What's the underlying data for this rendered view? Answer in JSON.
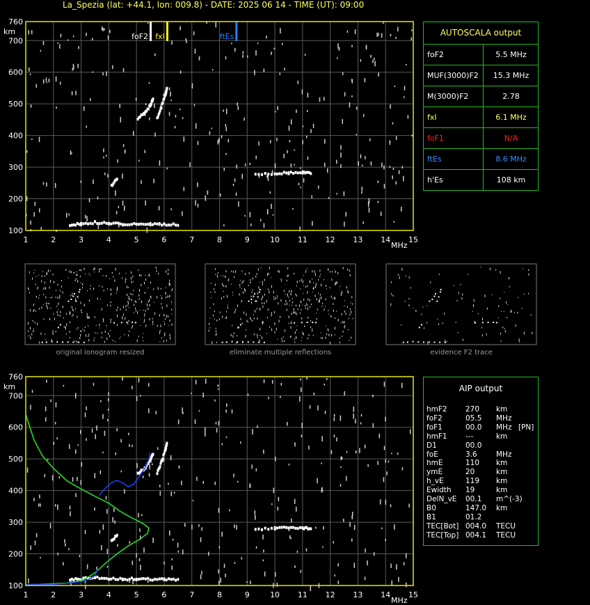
{
  "header": {
    "title": "La_Spezia (lat: +44.1, lon: 009.8) - DATE: 2025 06 14 - TIME (UT): 09:00"
  },
  "chart_data": [
    {
      "type": "scatter",
      "title": "",
      "ylabel": "km",
      "xlabel": "MHz",
      "xlim": [
        1,
        15
      ],
      "ylim": [
        100,
        760
      ],
      "x_ticks": [
        1,
        2,
        3,
        4,
        5,
        6,
        7,
        8,
        9,
        10,
        11,
        12,
        13,
        14,
        15
      ],
      "y_ticks": [
        100,
        200,
        300,
        400,
        500,
        600,
        700,
        760
      ],
      "grid": true,
      "markers": [
        {
          "label": "foF2",
          "x": 5.5,
          "color": "#ffffff"
        },
        {
          "label": "fxI",
          "x": 6.1,
          "color": "#ffff00"
        },
        {
          "label": "ftEs",
          "x": 8.6,
          "color": "#2a7fff"
        }
      ],
      "traces": [
        {
          "name": "",
          "points": [
            [
              2.6,
              118
            ],
            [
              3.0,
              120
            ],
            [
              3.5,
              125
            ],
            [
              4.0,
              122
            ],
            [
              4.5,
              120
            ],
            [
              5.0,
              121
            ],
            [
              5.5,
              120
            ],
            [
              6.0,
              119
            ],
            [
              6.5,
              118
            ]
          ]
        },
        {
          "name": "",
          "points": [
            [
              4.1,
              240
            ],
            [
              4.3,
              262
            ]
          ]
        },
        {
          "name": "",
          "points": [
            [
              5.05,
              455
            ],
            [
              5.3,
              470
            ],
            [
              5.5,
              495
            ],
            [
              5.6,
              515
            ]
          ]
        },
        {
          "name": "",
          "points": [
            [
              5.75,
              455
            ],
            [
              5.9,
              490
            ],
            [
              6.05,
              530
            ],
            [
              6.1,
              550
            ]
          ]
        },
        {
          "name": "",
          "points": [
            [
              9.3,
              278
            ],
            [
              10.0,
              280
            ],
            [
              10.5,
              282
            ],
            [
              11.0,
              282
            ],
            [
              11.3,
              280
            ]
          ]
        }
      ]
    },
    {
      "type": "scatter",
      "title": "",
      "ylabel": "km",
      "xlabel": "MHz",
      "xlim": [
        1,
        15
      ],
      "ylim": [
        100,
        760
      ],
      "x_ticks": [
        1,
        2,
        3,
        4,
        5,
        6,
        7,
        8,
        9,
        10,
        11,
        12,
        13,
        14,
        15
      ],
      "y_ticks": [
        100,
        200,
        300,
        400,
        500,
        600,
        700,
        760
      ],
      "grid": true,
      "traces": [
        {
          "name": "",
          "points": [
            [
              2.6,
              118
            ],
            [
              3.0,
              120
            ],
            [
              3.5,
              125
            ],
            [
              4.0,
              122
            ],
            [
              4.5,
              120
            ],
            [
              5.0,
              121
            ],
            [
              5.5,
              120
            ],
            [
              6.0,
              119
            ],
            [
              6.5,
              118
            ]
          ]
        },
        {
          "name": "",
          "points": [
            [
              4.1,
              240
            ],
            [
              4.3,
              262
            ]
          ]
        },
        {
          "name": "",
          "points": [
            [
              5.05,
              455
            ],
            [
              5.3,
              470
            ],
            [
              5.5,
              495
            ],
            [
              5.6,
              515
            ]
          ]
        },
        {
          "name": "",
          "points": [
            [
              5.75,
              455
            ],
            [
              5.9,
              490
            ],
            [
              6.05,
              530
            ],
            [
              6.1,
              550
            ]
          ]
        },
        {
          "name": "",
          "points": [
            [
              9.3,
              278
            ],
            [
              10.0,
              280
            ],
            [
              10.5,
              282
            ],
            [
              11.0,
              282
            ],
            [
              11.3,
              280
            ]
          ]
        }
      ],
      "lines": [
        {
          "name": "",
          "color": "#22dd22",
          "points": [
            [
              1.0,
              640
            ],
            [
              1.3,
              560
            ],
            [
              1.6,
              510
            ],
            [
              2.0,
              470
            ],
            [
              2.5,
              430
            ],
            [
              3.0,
              405
            ],
            [
              3.5,
              382
            ],
            [
              4.0,
              360
            ],
            [
              4.4,
              335
            ],
            [
              4.8,
              315
            ],
            [
              5.2,
              298
            ],
            [
              5.45,
              282
            ],
            [
              5.4,
              265
            ],
            [
              5.1,
              245
            ],
            [
              4.7,
              225
            ],
            [
              4.3,
              200
            ],
            [
              3.9,
              172
            ],
            [
              3.5,
              140
            ],
            [
              3.1,
              118
            ],
            [
              2.5,
              108
            ],
            [
              1.5,
              104
            ],
            [
              1.0,
              103
            ]
          ]
        },
        {
          "name": "",
          "color": "#1e3cff",
          "points": [
            [
              1.0,
              103
            ],
            [
              2.0,
              104
            ],
            [
              2.6,
              108
            ],
            [
              3.0,
              112
            ],
            [
              3.3,
              120
            ],
            [
              3.5,
              132
            ],
            [
              3.6,
              150
            ]
          ]
        },
        {
          "name": "",
          "color": "#1e3cff",
          "points": [
            [
              3.65,
              385
            ],
            [
              3.9,
              410
            ],
            [
              4.1,
              425
            ],
            [
              4.3,
              432
            ],
            [
              4.5,
              425
            ],
            [
              4.7,
              412
            ],
            [
              4.9,
              420
            ],
            [
              5.1,
              445
            ],
            [
              5.3,
              470
            ],
            [
              5.45,
              500
            ],
            [
              5.5,
              520
            ]
          ]
        }
      ]
    }
  ],
  "autoscala": {
    "title": "AUTOSCALA output",
    "rows": [
      {
        "key": "foF2",
        "value": "5.5 MHz",
        "key_color": "#ffffff",
        "value_color": "#ffffff"
      },
      {
        "key": "MUF(3000)F2",
        "value": "15.3 MHz",
        "key_color": "#ffffff",
        "value_color": "#ffffff"
      },
      {
        "key": "M(3000)F2",
        "value": "2.78",
        "key_color": "#ffffff",
        "value_color": "#ffffff"
      },
      {
        "key": "fxI",
        "value": "6.1 MHz",
        "key_color": "#ffff66",
        "value_color": "#ffff66"
      },
      {
        "key": "foF1",
        "value": "N/A",
        "key_color": "#ff2020",
        "value_color": "#ff2020"
      },
      {
        "key": "ftEs",
        "value": "8.6 MHz",
        "key_color": "#3a8cff",
        "value_color": "#3a8cff"
      },
      {
        "key": "h'Es",
        "value": "108     km",
        "key_color": "#ffffff",
        "value_color": "#ffffff"
      }
    ]
  },
  "thumbnails": [
    {
      "caption": "original ionogram resized"
    },
    {
      "caption": "eliminate multiple reflections"
    },
    {
      "caption": "evidence F2 trace"
    }
  ],
  "aip": {
    "title": "AIP output",
    "rows": [
      {
        "k": "hmF2",
        "v": "270",
        "u": "km",
        "x": ""
      },
      {
        "k": "foF2",
        "v": "05.5",
        "u": "MHz",
        "x": ""
      },
      {
        "k": "foF1",
        "v": "00.0",
        "u": "MHz",
        "x": "[PN]"
      },
      {
        "k": "hmF1",
        "v": "---",
        "u": "km",
        "x": ""
      },
      {
        "k": "D1",
        "v": "00.0",
        "u": "",
        "x": ""
      },
      {
        "k": "foE",
        "v": "3.6",
        "u": "MHz",
        "x": ""
      },
      {
        "k": "hmE",
        "v": "110",
        "u": "km",
        "x": ""
      },
      {
        "k": "ymE",
        "v": "20",
        "u": "km",
        "x": ""
      },
      {
        "k": "h_vE",
        "v": "119",
        "u": "km",
        "x": ""
      },
      {
        "k": "Ewidth",
        "v": "19",
        "u": "km",
        "x": ""
      },
      {
        "k": "DelN_vE",
        "v": "00.1",
        "u": "m^(-3)",
        "x": ""
      },
      {
        "k": "B0",
        "v": "147.0",
        "u": "km",
        "x": ""
      },
      {
        "k": "B1",
        "v": "01.2",
        "u": "",
        "x": ""
      },
      {
        "k": "TEC[Bot]",
        "v": "004.0",
        "u": "TECU",
        "x": ""
      },
      {
        "k": "TEC[Top]",
        "v": "004.1",
        "u": "TECU",
        "x": ""
      }
    ]
  }
}
